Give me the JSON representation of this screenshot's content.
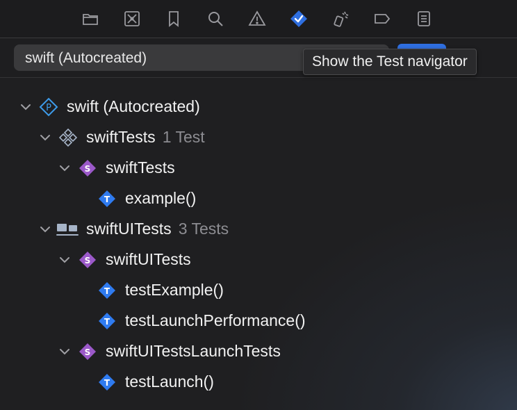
{
  "toolbar": {
    "icons": [
      {
        "name": "project-navigator-icon"
      },
      {
        "name": "source-control-navigator-icon"
      },
      {
        "name": "bookmark-navigator-icon"
      },
      {
        "name": "find-navigator-icon"
      },
      {
        "name": "issue-navigator-icon"
      },
      {
        "name": "test-navigator-icon",
        "selected": true
      },
      {
        "name": "debug-navigator-icon"
      },
      {
        "name": "breakpoint-navigator-icon"
      },
      {
        "name": "report-navigator-icon"
      }
    ],
    "accent_color": "#2f6fe0"
  },
  "scheme": {
    "label": "swift (Autocreated)"
  },
  "tooltip": {
    "text": "Show the Test navigator"
  },
  "tree": {
    "rows": [
      {
        "label": "swift (Autocreated)",
        "count": "",
        "kind": "test-plan",
        "expanded": true
      },
      {
        "label": "swiftTests",
        "count": "1 Test",
        "kind": "unit-test-bundle",
        "expanded": true
      },
      {
        "label": "swiftTests",
        "count": "",
        "kind": "test-class",
        "expanded": true
      },
      {
        "label": "example()",
        "count": "",
        "kind": "test-method"
      },
      {
        "label": "swiftUITests",
        "count": "3 Tests",
        "kind": "ui-test-bundle",
        "expanded": true
      },
      {
        "label": "swiftUITests",
        "count": "",
        "kind": "test-class",
        "expanded": true
      },
      {
        "label": "testExample()",
        "count": "",
        "kind": "test-method"
      },
      {
        "label": "testLaunchPerformance()",
        "count": "",
        "kind": "test-method"
      },
      {
        "label": "swiftUITestsLaunchTests",
        "count": "",
        "kind": "test-class",
        "expanded": true
      },
      {
        "label": "testLaunch()",
        "count": "",
        "kind": "test-method"
      }
    ]
  },
  "colors": {
    "class_badge": "#9b59c9",
    "method_badge": "#2f7bf0",
    "plan_icon": "#3d9be9",
    "count_text": "#8d8d92"
  }
}
